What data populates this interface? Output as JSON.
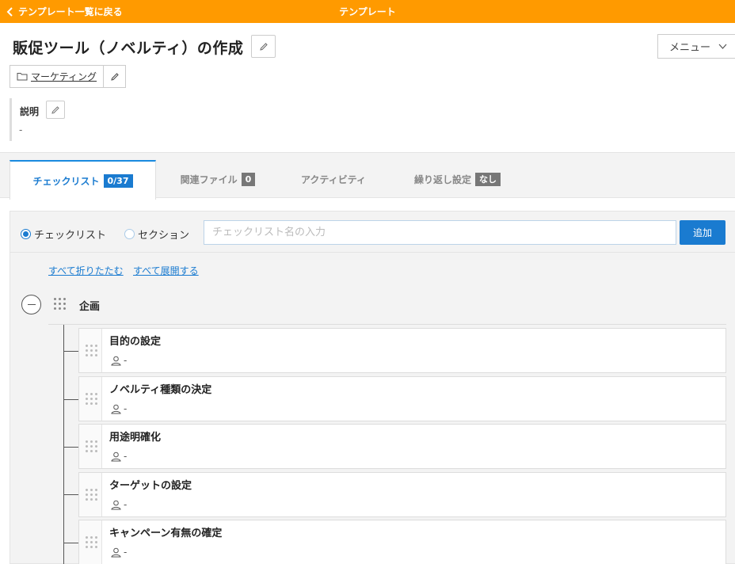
{
  "topbar": {
    "back_label": "テンプレート一覧に戻る",
    "title": "テンプレート"
  },
  "header": {
    "page_title": "販促ツール（ノベルティ）の作成",
    "menu_label": "メニュー"
  },
  "category": {
    "label": "マーケティング"
  },
  "description": {
    "label": "説明",
    "value": "-"
  },
  "tabs": [
    {
      "label": "チェックリスト",
      "badge": "0/37"
    },
    {
      "label": "関連ファイル",
      "badge": "0"
    },
    {
      "label": "アクティビティ",
      "badge": ""
    },
    {
      "label": "繰り返し設定",
      "badge": "なし"
    }
  ],
  "add_form": {
    "radio_checklist": "チェックリスト",
    "radio_section": "セクション",
    "input_placeholder": "チェックリスト名の入力",
    "input_value": "",
    "add_button": "追加"
  },
  "links": {
    "collapse_all": "すべて折りたたむ",
    "expand_all": "すべて展開する"
  },
  "section": {
    "name": "企画",
    "items": [
      {
        "name": "目的の設定",
        "assignee": "-"
      },
      {
        "name": "ノベルティ種類の決定",
        "assignee": "-"
      },
      {
        "name": "用途明確化",
        "assignee": "-"
      },
      {
        "name": "ターゲットの設定",
        "assignee": "-"
      },
      {
        "name": "キャンペーン有無の確定",
        "assignee": "-"
      }
    ]
  },
  "colors": {
    "topbar": "#ff9a00",
    "accent": "#1a7bd0",
    "badge_gray": "#777777"
  },
  "icons": [
    "chevron-left-icon",
    "pencil-icon",
    "chevron-down-icon",
    "folder-icon",
    "minus-circle-icon",
    "drag-handle-icon",
    "user-icon"
  ]
}
